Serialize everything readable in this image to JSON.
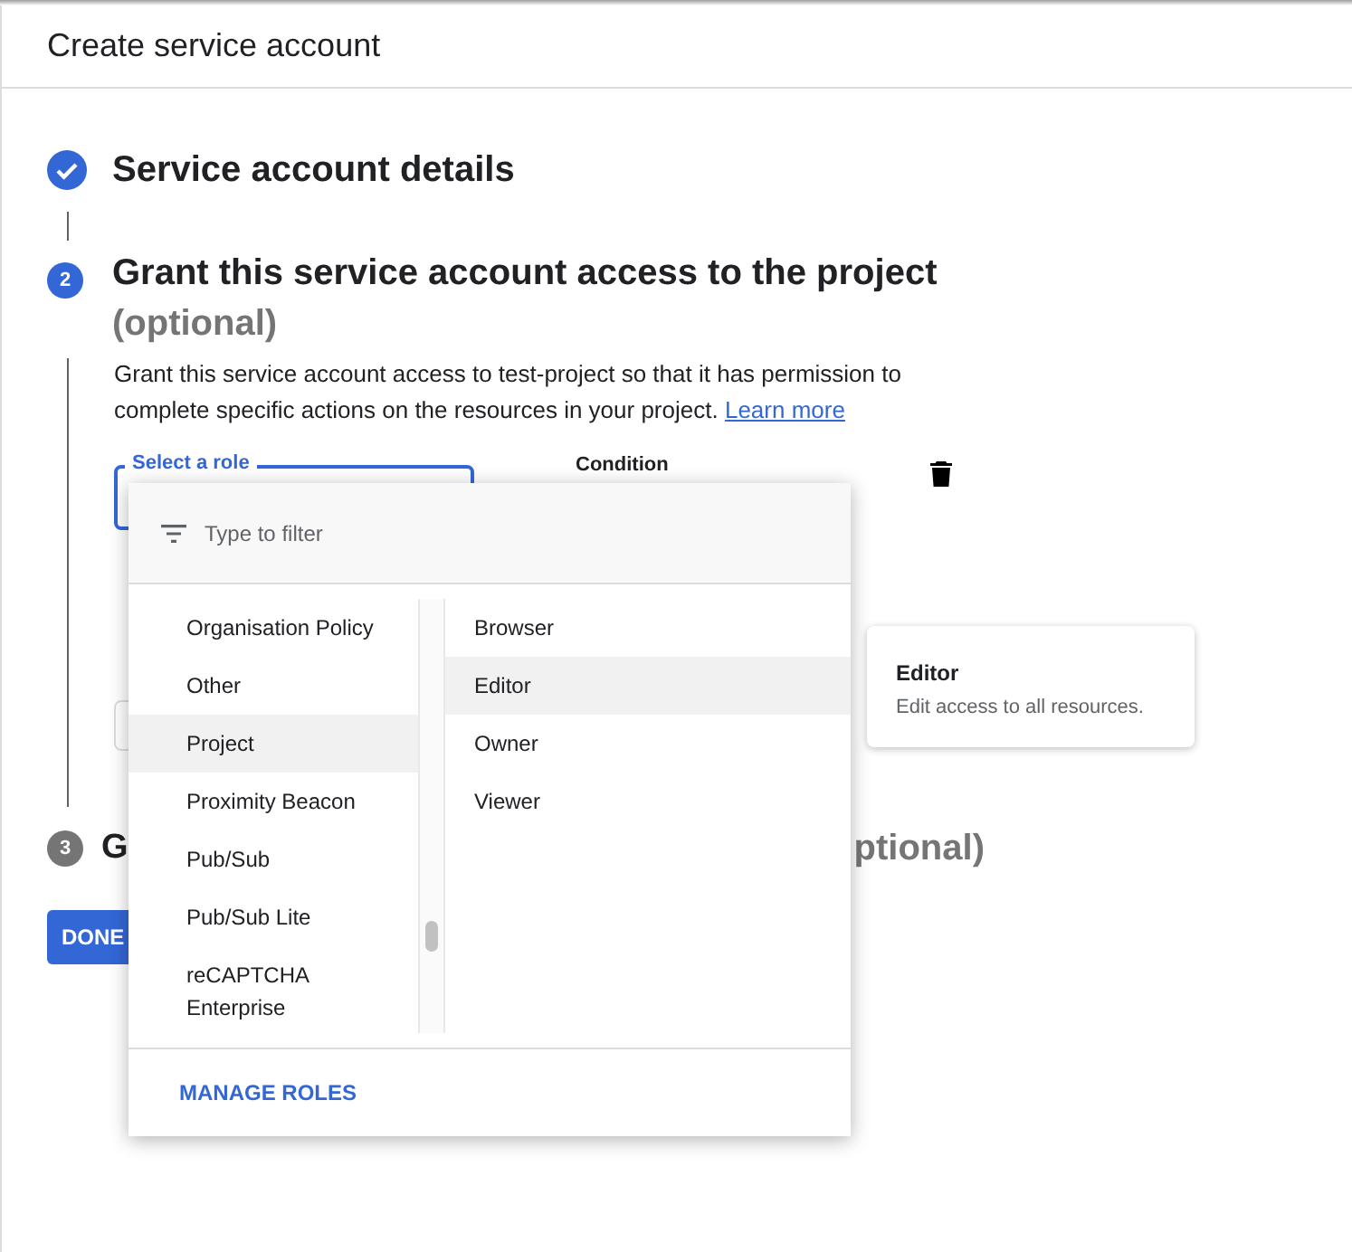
{
  "header": {
    "title": "Create service account"
  },
  "steps": [
    {
      "kind": "done",
      "title": "Service account details"
    },
    {
      "kind": "active",
      "number": "2",
      "title": "Grant this service account access to the project",
      "optional": "(optional)",
      "description": "Grant this service account access to test-project so that it has permission to complete specific actions on the resources in your project.",
      "link": "Learn more"
    },
    {
      "kind": "pending",
      "number": "3",
      "title_start": "G",
      "title_end": "ptional)"
    }
  ],
  "role_field": {
    "label": "Select a role"
  },
  "condition": {
    "label": "Condition"
  },
  "done_button": "DONE",
  "dropdown": {
    "placeholder": "Type to filter",
    "categories": [
      {
        "label": "Organisation Policy",
        "selected": false
      },
      {
        "label": "Other",
        "selected": false
      },
      {
        "label": "Project",
        "selected": true
      },
      {
        "label": "Proximity Beacon",
        "selected": false
      },
      {
        "label": "Pub/Sub",
        "selected": false
      },
      {
        "label": "Pub/Sub Lite",
        "selected": false
      },
      {
        "label": "reCAPTCHA Enterprise",
        "selected": false
      }
    ],
    "roles": [
      {
        "label": "Browser",
        "selected": false
      },
      {
        "label": "Editor",
        "selected": true
      },
      {
        "label": "Owner",
        "selected": false
      },
      {
        "label": "Viewer",
        "selected": false
      }
    ],
    "footer_link": "MANAGE ROLES"
  },
  "tooltip": {
    "title": "Editor",
    "description": "Edit access to all resources."
  }
}
